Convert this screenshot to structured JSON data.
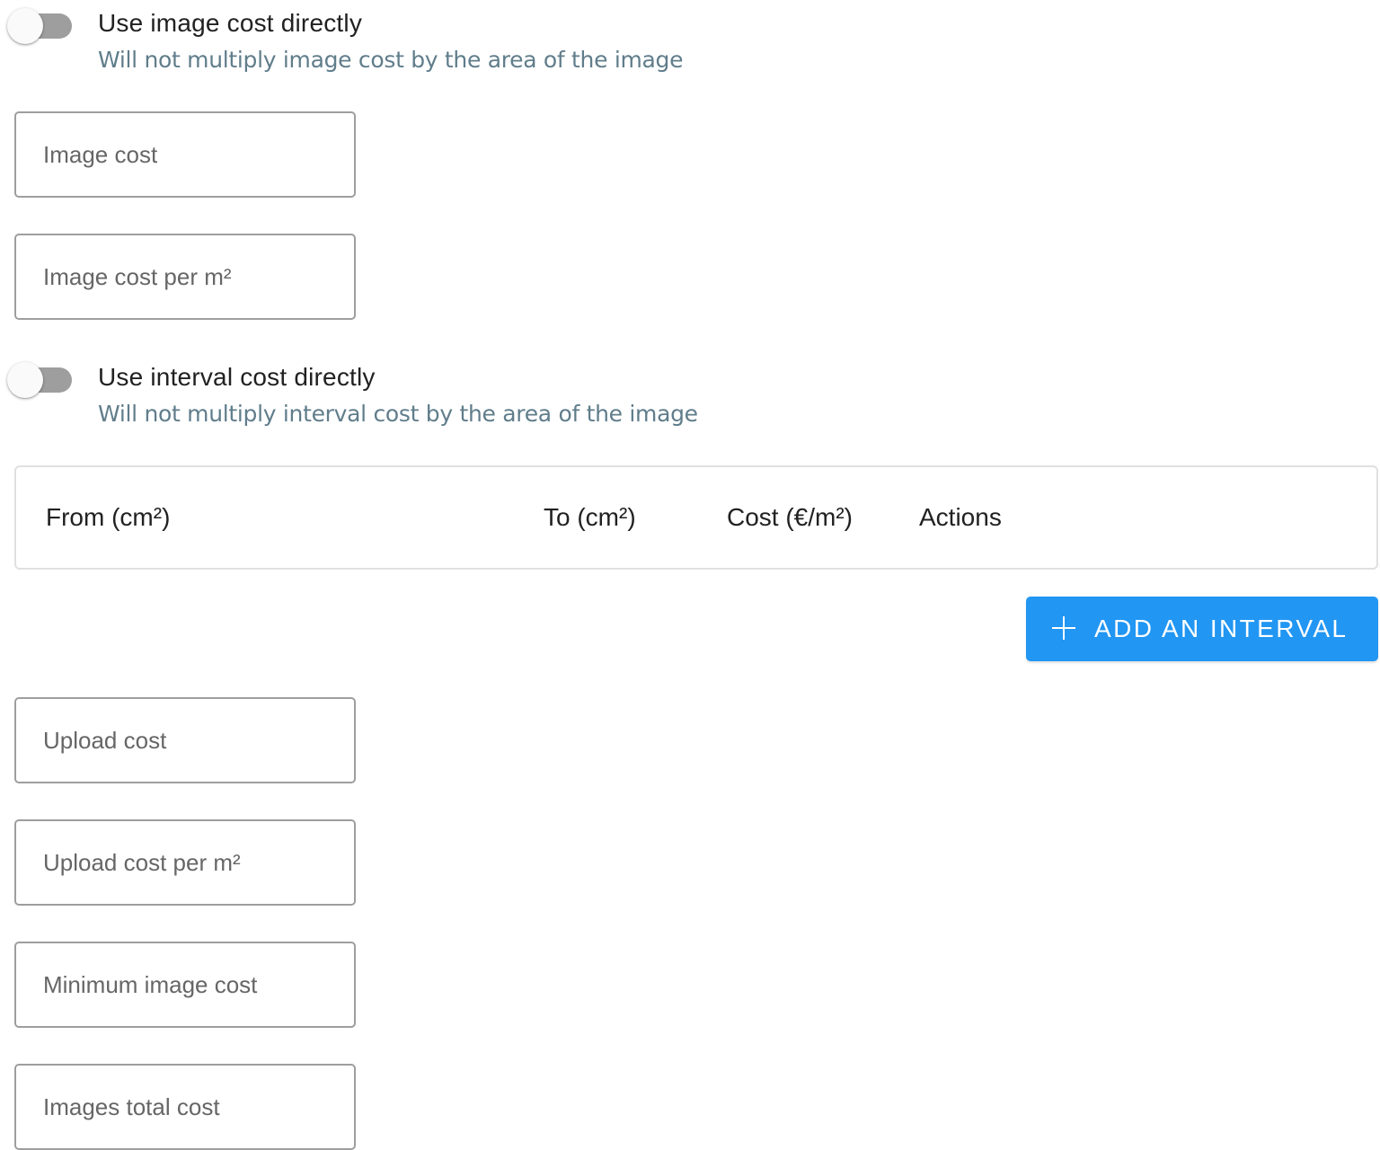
{
  "image_cost_toggle": {
    "label": "Use image cost directly",
    "hint": "Will not multiply image cost by the area of the image",
    "checked": false
  },
  "image_cost_field": {
    "placeholder": "Image cost",
    "value": ""
  },
  "image_cost_per_m2_field": {
    "placeholder": "Image cost per m²",
    "value": ""
  },
  "interval_cost_toggle": {
    "label": "Use interval cost directly",
    "hint": "Will not multiply interval cost by the area of the image",
    "checked": false
  },
  "interval_table": {
    "columns": [
      "From (cm²)",
      "To (cm²)",
      "Cost (€/m²)",
      "Actions"
    ],
    "rows": []
  },
  "add_interval_button": {
    "label": "ADD AN INTERVAL",
    "icon": "plus-icon",
    "color": "#2196f3"
  },
  "upload_cost_field": {
    "placeholder": "Upload cost",
    "value": ""
  },
  "upload_cost_per_m2_field": {
    "placeholder": "Upload cost per m²",
    "value": ""
  },
  "minimum_image_cost_field": {
    "placeholder": "Minimum image cost",
    "value": ""
  },
  "images_total_cost_field": {
    "placeholder": "Images total cost",
    "value": ""
  }
}
